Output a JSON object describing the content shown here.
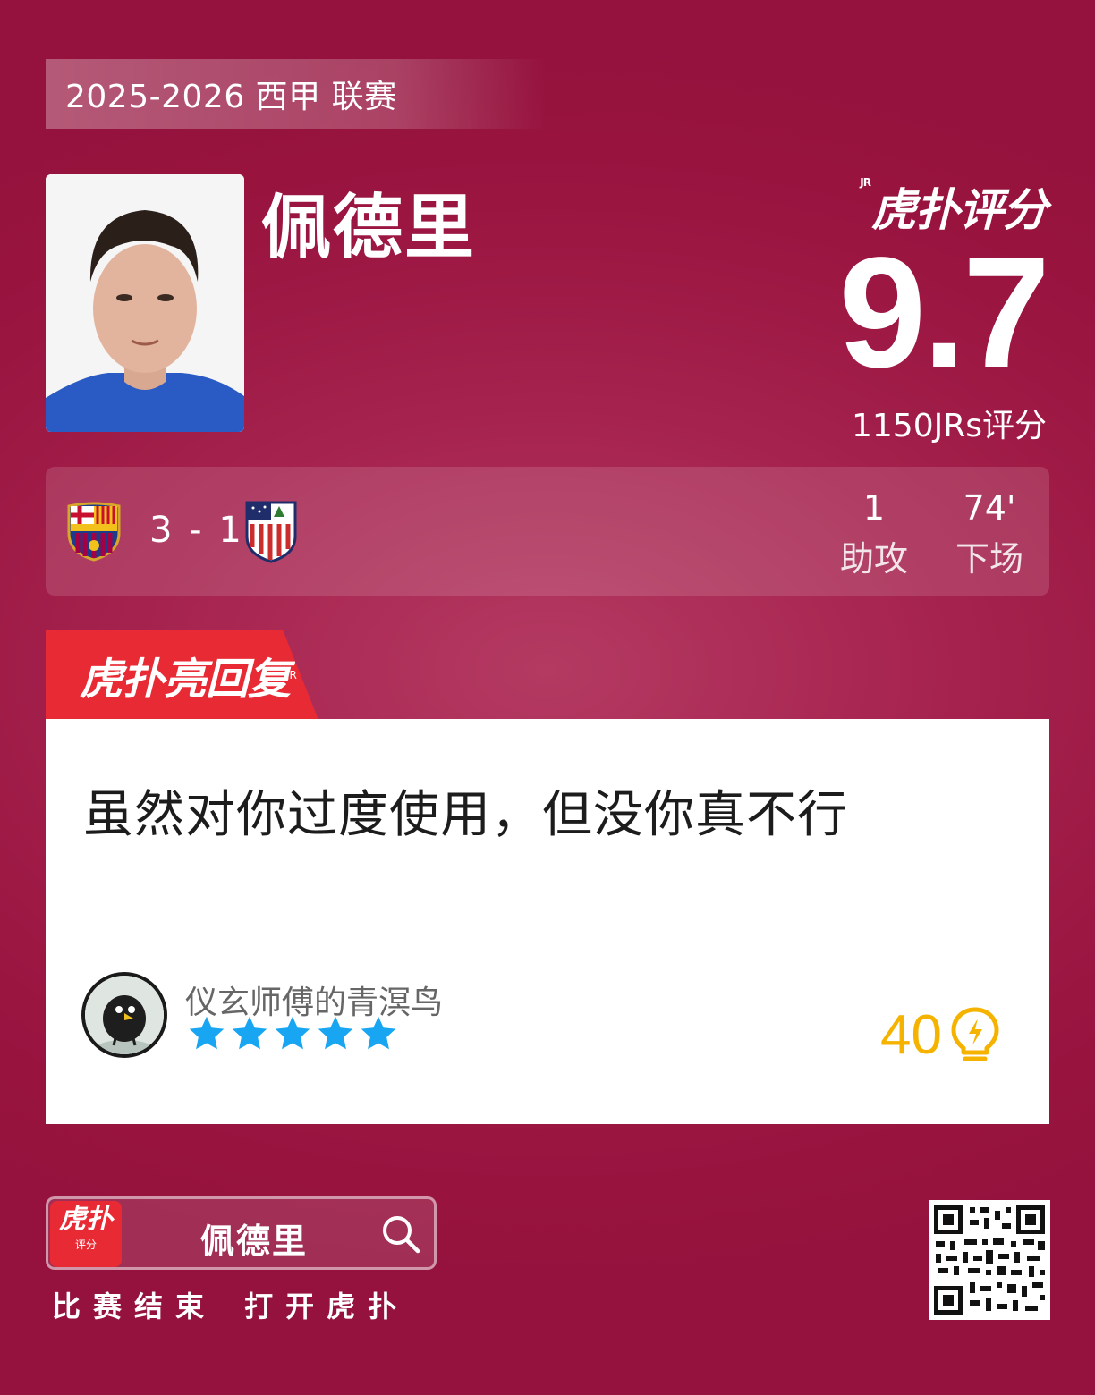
{
  "season_label": "2025-2026 西甲 联赛",
  "player": {
    "name": "佩德里"
  },
  "rating": {
    "brand": "虎扑评分",
    "brand_jr": "JR",
    "score": "9.7",
    "count_text": "1150JRs评分"
  },
  "match": {
    "home_team_icon": "fc-barcelona-crest-icon",
    "away_team_icon": "atletico-madrid-crest-icon",
    "score": "3 - 1",
    "stats": [
      {
        "value": "1",
        "label": "助攻"
      },
      {
        "value": "74'",
        "label": "下场"
      }
    ]
  },
  "highlight": {
    "tab_label": "虎扑亮回复",
    "tab_jr": "JR",
    "comment": "虽然对你过度使用，但没你真不行",
    "user": {
      "name": "仪玄师傅的青溟鸟",
      "stars": 5
    },
    "likes": "40",
    "colors": {
      "like": "#f5b300",
      "star": "#18a6f2",
      "tab": "#e82a35"
    }
  },
  "footer": {
    "app_icon_main": "虎扑",
    "app_icon_sub": "评分",
    "search_name": "佩德里",
    "cta": "比赛结束 打开虎扑"
  }
}
